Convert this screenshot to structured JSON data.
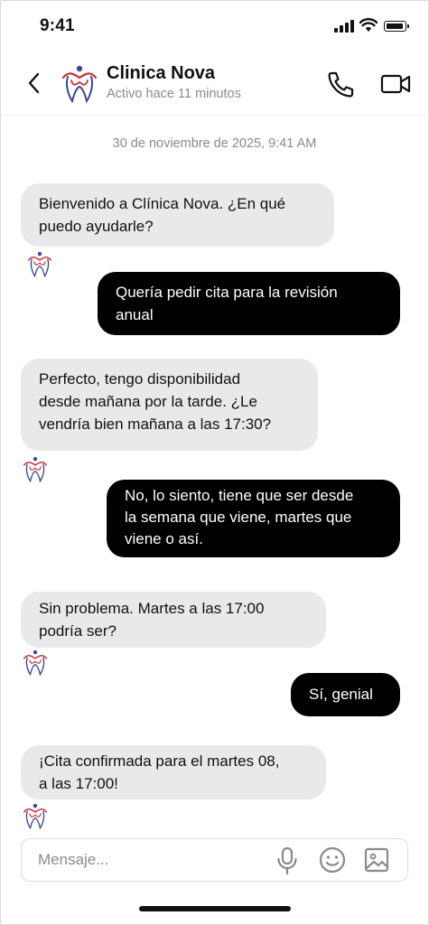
{
  "status_bar": {
    "time": "9:41"
  },
  "header": {
    "contact_name": "Clinica Nova",
    "contact_status": "Activo hace 11 minutos"
  },
  "chat": {
    "timestamp": "30 de noviembre de 2025, 9:41 AM",
    "messages": [
      {
        "from": "clinic",
        "line1": "Bienvenido a Clínica Nova. ¿En qué",
        "line2": "puedo ayudarle?"
      },
      {
        "from": "user",
        "line1": "Quería pedir cita para la revisión",
        "line2": "anual"
      },
      {
        "from": "clinic",
        "line1": "Perfecto, tengo disponibilidad",
        "line2": "desde mañana por la tarde. ¿Le",
        "line3": "vendría bien mañana a las 17:30?"
      },
      {
        "from": "user",
        "line1": "No, lo siento, tiene que ser desde",
        "line2": "la semana que viene, martes que",
        "line3": "viene o así."
      },
      {
        "from": "clinic",
        "line1": "Sin problema. Martes a las 17:00",
        "line2": "podría ser?"
      },
      {
        "from": "user",
        "line1": "Sí, genial"
      },
      {
        "from": "clinic",
        "line1": "¡Cita confirmada para el martes 08,",
        "line2": "a las 17:00!"
      }
    ]
  },
  "composer": {
    "placeholder": "Mensaje..."
  },
  "icons": {
    "back": "chevron-left-icon",
    "call": "phone-icon",
    "video": "video-camera-icon",
    "mic": "microphone-icon",
    "emoji": "smiley-icon",
    "image": "image-icon",
    "logo": "clinic-tooth-logo"
  },
  "colors": {
    "incoming_bubble": "#e9e9eb",
    "outgoing_bubble": "#000000",
    "logo_blue": "#3d4a8f",
    "logo_red": "#c8323c"
  }
}
